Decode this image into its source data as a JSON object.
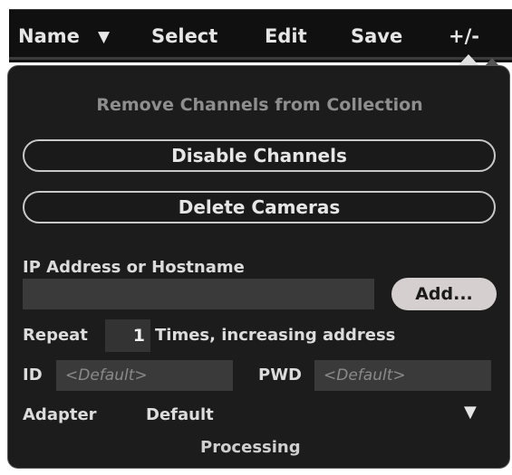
{
  "menubar": {
    "name_label": "Name",
    "name_arrow": "▼",
    "select_label": "Select",
    "edit_label": "Edit",
    "save_label": "Save",
    "plusminus_label": "+/-"
  },
  "panel": {
    "section_title": "Remove Channels from Collection",
    "disable_channels_label": "Disable Channels",
    "delete_cameras_label": "Delete Cameras",
    "ip_label": "IP Address or Hostname",
    "ip_value": "",
    "add_label": "Add...",
    "repeat_label": "Repeat",
    "repeat_value": "1",
    "repeat_suffix": "Times, increasing address",
    "id_label": "ID",
    "id_placeholder": "<Default>",
    "pwd_label": "PWD",
    "pwd_placeholder": "<Default>",
    "adapter_label": "Adapter",
    "adapter_value": "Default",
    "adapter_arrow": "▼",
    "status_text": "Processing"
  },
  "colors": {
    "panel_background": "#1c1c1c",
    "menubar_background": "#101010",
    "add_button": "#d6cfcf",
    "title_text": "#8e8e8e"
  }
}
